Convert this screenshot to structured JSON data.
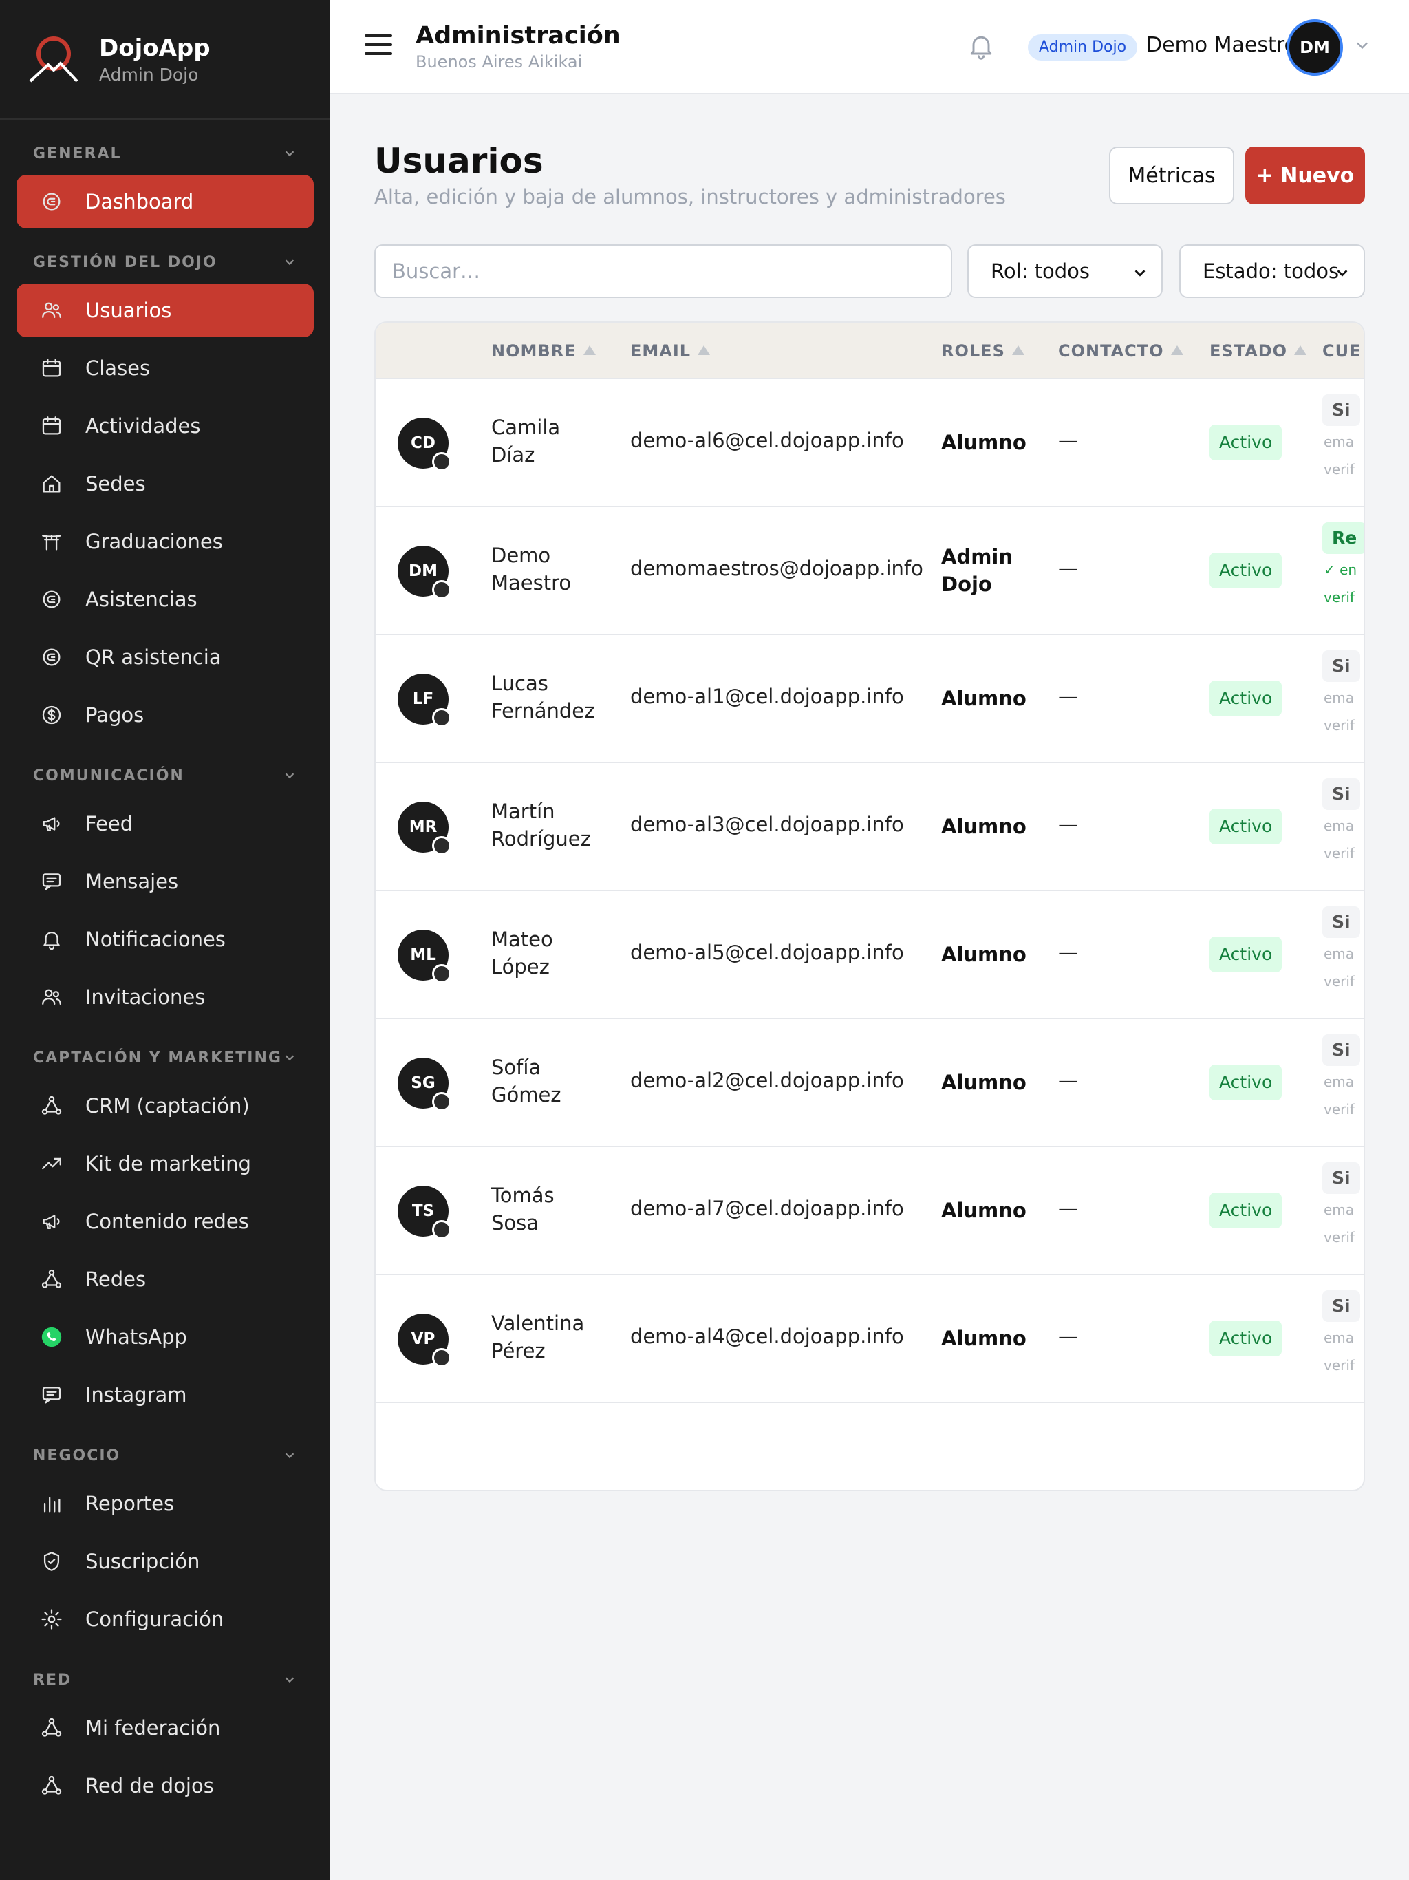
{
  "brand": {
    "title": "DojoApp",
    "subtitle": "Admin Dojo"
  },
  "sidebar": {
    "sections": [
      {
        "title": "GENERAL",
        "items": [
          {
            "label": "Dashboard",
            "icon": "dashboard-icon",
            "active": true
          }
        ]
      },
      {
        "title": "GESTIÓN DEL DOJO",
        "items": [
          {
            "label": "Usuarios",
            "icon": "users-icon",
            "active": true
          },
          {
            "label": "Clases",
            "icon": "calendar-icon"
          },
          {
            "label": "Actividades",
            "icon": "calendar-icon"
          },
          {
            "label": "Sedes",
            "icon": "home-icon"
          },
          {
            "label": "Graduaciones",
            "icon": "torii-icon"
          },
          {
            "label": "Asistencias",
            "icon": "dashboard-icon"
          },
          {
            "label": "QR asistencia",
            "icon": "dashboard-icon"
          },
          {
            "label": "Pagos",
            "icon": "dollar-icon"
          }
        ]
      },
      {
        "title": "COMUNICACIÓN",
        "items": [
          {
            "label": "Feed",
            "icon": "megaphone-icon"
          },
          {
            "label": "Mensajes",
            "icon": "message-icon"
          },
          {
            "label": "Notificaciones",
            "icon": "bell-icon"
          },
          {
            "label": "Invitaciones",
            "icon": "users-icon"
          }
        ]
      },
      {
        "title": "CAPTACIÓN Y MARKETING",
        "items": [
          {
            "label": "CRM (captación)",
            "icon": "network-icon"
          },
          {
            "label": "Kit de marketing",
            "icon": "trend-icon"
          },
          {
            "label": "Contenido redes",
            "icon": "megaphone-icon"
          },
          {
            "label": "Redes",
            "icon": "network-icon"
          },
          {
            "label": "WhatsApp",
            "icon": "whatsapp-icon"
          },
          {
            "label": "Instagram",
            "icon": "message-icon"
          }
        ]
      },
      {
        "title": "NEGOCIO",
        "items": [
          {
            "label": "Reportes",
            "icon": "bar-chart-icon"
          },
          {
            "label": "Suscripción",
            "icon": "shield-icon"
          },
          {
            "label": "Configuración",
            "icon": "gear-icon"
          }
        ]
      },
      {
        "title": "RED",
        "items": [
          {
            "label": "Mi federación",
            "icon": "network-icon"
          },
          {
            "label": "Red de dojos",
            "icon": "network-icon"
          }
        ]
      }
    ]
  },
  "topbar": {
    "title": "Administración",
    "subtitle": "Buenos Aires Aikikai",
    "badge": "Admin Dojo",
    "user_name": "Demo Maestro",
    "user_initials": "DM"
  },
  "page": {
    "title": "Usuarios",
    "subtitle": "Alta, edición y baja de alumnos, instructores y administradores",
    "metrics_label": "Métricas",
    "new_label": "+ Nuevo",
    "search_placeholder": "Buscar…",
    "role_filter": "Rol: todos",
    "status_filter": "Estado: todos"
  },
  "table": {
    "headers": [
      "NOMBRE",
      "EMAIL",
      "ROLES",
      "CONTACTO",
      "ESTADO",
      "CUE"
    ],
    "rows": [
      {
        "initials": "CD",
        "first": "Camila",
        "last": "Díaz",
        "email": "demo-al6@cel.dojoapp.info",
        "role1": "Alumno",
        "role2": "",
        "contact": "—",
        "status": "Activo",
        "cuenta_tag": "Si",
        "cuenta_l1": "ema",
        "cuenta_l2": "verif",
        "verified": false
      },
      {
        "initials": "DM",
        "first": "Demo",
        "last": "Maestro",
        "email": "demomaestros@dojoapp.info",
        "role1": "Admin",
        "role2": "Dojo",
        "contact": "—",
        "status": "Activo",
        "cuenta_tag": "Re",
        "cuenta_l1": "✓ en",
        "cuenta_l2": "verif",
        "verified": true
      },
      {
        "initials": "LF",
        "first": "Lucas",
        "last": "Fernández",
        "email": "demo-al1@cel.dojoapp.info",
        "role1": "Alumno",
        "role2": "",
        "contact": "—",
        "status": "Activo",
        "cuenta_tag": "Si",
        "cuenta_l1": "ema",
        "cuenta_l2": "verif",
        "verified": false
      },
      {
        "initials": "MR",
        "first": "Martín",
        "last": "Rodríguez",
        "email": "demo-al3@cel.dojoapp.info",
        "role1": "Alumno",
        "role2": "",
        "contact": "—",
        "status": "Activo",
        "cuenta_tag": "Si",
        "cuenta_l1": "ema",
        "cuenta_l2": "verif",
        "verified": false
      },
      {
        "initials": "ML",
        "first": "Mateo",
        "last": "López",
        "email": "demo-al5@cel.dojoapp.info",
        "role1": "Alumno",
        "role2": "",
        "contact": "—",
        "status": "Activo",
        "cuenta_tag": "Si",
        "cuenta_l1": "ema",
        "cuenta_l2": "verif",
        "verified": false
      },
      {
        "initials": "SG",
        "first": "Sofía",
        "last": "Gómez",
        "email": "demo-al2@cel.dojoapp.info",
        "role1": "Alumno",
        "role2": "",
        "contact": "—",
        "status": "Activo",
        "cuenta_tag": "Si",
        "cuenta_l1": "ema",
        "cuenta_l2": "verif",
        "verified": false
      },
      {
        "initials": "TS",
        "first": "Tomás",
        "last": "Sosa",
        "email": "demo-al7@cel.dojoapp.info",
        "role1": "Alumno",
        "role2": "",
        "contact": "—",
        "status": "Activo",
        "cuenta_tag": "Si",
        "cuenta_l1": "ema",
        "cuenta_l2": "verif",
        "verified": false
      },
      {
        "initials": "VP",
        "first": "Valentina",
        "last": "Pérez",
        "email": "demo-al4@cel.dojoapp.info",
        "role1": "Alumno",
        "role2": "",
        "contact": "—",
        "status": "Activo",
        "cuenta_tag": "Si",
        "cuenta_l1": "ema",
        "cuenta_l2": "verif",
        "verified": false
      }
    ]
  }
}
